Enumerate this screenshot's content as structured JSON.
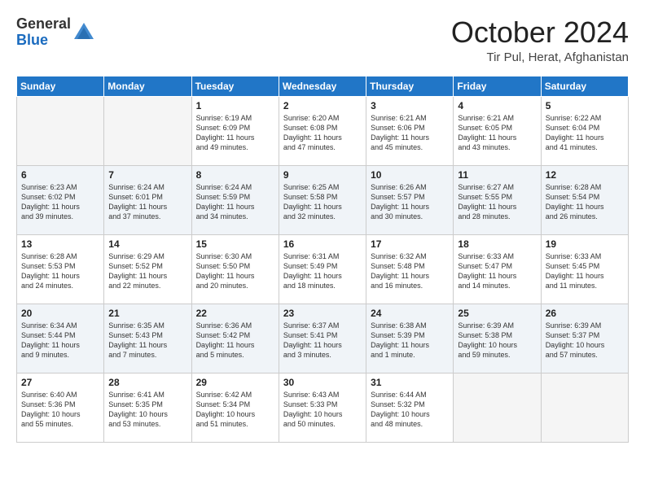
{
  "header": {
    "logo_general": "General",
    "logo_blue": "Blue",
    "month_year": "October 2024",
    "location": "Tir Pul, Herat, Afghanistan"
  },
  "days_of_week": [
    "Sunday",
    "Monday",
    "Tuesday",
    "Wednesday",
    "Thursday",
    "Friday",
    "Saturday"
  ],
  "weeks": [
    [
      {
        "day": "",
        "lines": []
      },
      {
        "day": "",
        "lines": []
      },
      {
        "day": "1",
        "lines": [
          "Sunrise: 6:19 AM",
          "Sunset: 6:09 PM",
          "Daylight: 11 hours",
          "and 49 minutes."
        ]
      },
      {
        "day": "2",
        "lines": [
          "Sunrise: 6:20 AM",
          "Sunset: 6:08 PM",
          "Daylight: 11 hours",
          "and 47 minutes."
        ]
      },
      {
        "day": "3",
        "lines": [
          "Sunrise: 6:21 AM",
          "Sunset: 6:06 PM",
          "Daylight: 11 hours",
          "and 45 minutes."
        ]
      },
      {
        "day": "4",
        "lines": [
          "Sunrise: 6:21 AM",
          "Sunset: 6:05 PM",
          "Daylight: 11 hours",
          "and 43 minutes."
        ]
      },
      {
        "day": "5",
        "lines": [
          "Sunrise: 6:22 AM",
          "Sunset: 6:04 PM",
          "Daylight: 11 hours",
          "and 41 minutes."
        ]
      }
    ],
    [
      {
        "day": "6",
        "lines": [
          "Sunrise: 6:23 AM",
          "Sunset: 6:02 PM",
          "Daylight: 11 hours",
          "and 39 minutes."
        ]
      },
      {
        "day": "7",
        "lines": [
          "Sunrise: 6:24 AM",
          "Sunset: 6:01 PM",
          "Daylight: 11 hours",
          "and 37 minutes."
        ]
      },
      {
        "day": "8",
        "lines": [
          "Sunrise: 6:24 AM",
          "Sunset: 5:59 PM",
          "Daylight: 11 hours",
          "and 34 minutes."
        ]
      },
      {
        "day": "9",
        "lines": [
          "Sunrise: 6:25 AM",
          "Sunset: 5:58 PM",
          "Daylight: 11 hours",
          "and 32 minutes."
        ]
      },
      {
        "day": "10",
        "lines": [
          "Sunrise: 6:26 AM",
          "Sunset: 5:57 PM",
          "Daylight: 11 hours",
          "and 30 minutes."
        ]
      },
      {
        "day": "11",
        "lines": [
          "Sunrise: 6:27 AM",
          "Sunset: 5:55 PM",
          "Daylight: 11 hours",
          "and 28 minutes."
        ]
      },
      {
        "day": "12",
        "lines": [
          "Sunrise: 6:28 AM",
          "Sunset: 5:54 PM",
          "Daylight: 11 hours",
          "and 26 minutes."
        ]
      }
    ],
    [
      {
        "day": "13",
        "lines": [
          "Sunrise: 6:28 AM",
          "Sunset: 5:53 PM",
          "Daylight: 11 hours",
          "and 24 minutes."
        ]
      },
      {
        "day": "14",
        "lines": [
          "Sunrise: 6:29 AM",
          "Sunset: 5:52 PM",
          "Daylight: 11 hours",
          "and 22 minutes."
        ]
      },
      {
        "day": "15",
        "lines": [
          "Sunrise: 6:30 AM",
          "Sunset: 5:50 PM",
          "Daylight: 11 hours",
          "and 20 minutes."
        ]
      },
      {
        "day": "16",
        "lines": [
          "Sunrise: 6:31 AM",
          "Sunset: 5:49 PM",
          "Daylight: 11 hours",
          "and 18 minutes."
        ]
      },
      {
        "day": "17",
        "lines": [
          "Sunrise: 6:32 AM",
          "Sunset: 5:48 PM",
          "Daylight: 11 hours",
          "and 16 minutes."
        ]
      },
      {
        "day": "18",
        "lines": [
          "Sunrise: 6:33 AM",
          "Sunset: 5:47 PM",
          "Daylight: 11 hours",
          "and 14 minutes."
        ]
      },
      {
        "day": "19",
        "lines": [
          "Sunrise: 6:33 AM",
          "Sunset: 5:45 PM",
          "Daylight: 11 hours",
          "and 11 minutes."
        ]
      }
    ],
    [
      {
        "day": "20",
        "lines": [
          "Sunrise: 6:34 AM",
          "Sunset: 5:44 PM",
          "Daylight: 11 hours",
          "and 9 minutes."
        ]
      },
      {
        "day": "21",
        "lines": [
          "Sunrise: 6:35 AM",
          "Sunset: 5:43 PM",
          "Daylight: 11 hours",
          "and 7 minutes."
        ]
      },
      {
        "day": "22",
        "lines": [
          "Sunrise: 6:36 AM",
          "Sunset: 5:42 PM",
          "Daylight: 11 hours",
          "and 5 minutes."
        ]
      },
      {
        "day": "23",
        "lines": [
          "Sunrise: 6:37 AM",
          "Sunset: 5:41 PM",
          "Daylight: 11 hours",
          "and 3 minutes."
        ]
      },
      {
        "day": "24",
        "lines": [
          "Sunrise: 6:38 AM",
          "Sunset: 5:39 PM",
          "Daylight: 11 hours",
          "and 1 minute."
        ]
      },
      {
        "day": "25",
        "lines": [
          "Sunrise: 6:39 AM",
          "Sunset: 5:38 PM",
          "Daylight: 10 hours",
          "and 59 minutes."
        ]
      },
      {
        "day": "26",
        "lines": [
          "Sunrise: 6:39 AM",
          "Sunset: 5:37 PM",
          "Daylight: 10 hours",
          "and 57 minutes."
        ]
      }
    ],
    [
      {
        "day": "27",
        "lines": [
          "Sunrise: 6:40 AM",
          "Sunset: 5:36 PM",
          "Daylight: 10 hours",
          "and 55 minutes."
        ]
      },
      {
        "day": "28",
        "lines": [
          "Sunrise: 6:41 AM",
          "Sunset: 5:35 PM",
          "Daylight: 10 hours",
          "and 53 minutes."
        ]
      },
      {
        "day": "29",
        "lines": [
          "Sunrise: 6:42 AM",
          "Sunset: 5:34 PM",
          "Daylight: 10 hours",
          "and 51 minutes."
        ]
      },
      {
        "day": "30",
        "lines": [
          "Sunrise: 6:43 AM",
          "Sunset: 5:33 PM",
          "Daylight: 10 hours",
          "and 50 minutes."
        ]
      },
      {
        "day": "31",
        "lines": [
          "Sunrise: 6:44 AM",
          "Sunset: 5:32 PM",
          "Daylight: 10 hours",
          "and 48 minutes."
        ]
      },
      {
        "day": "",
        "lines": []
      },
      {
        "day": "",
        "lines": []
      }
    ]
  ]
}
